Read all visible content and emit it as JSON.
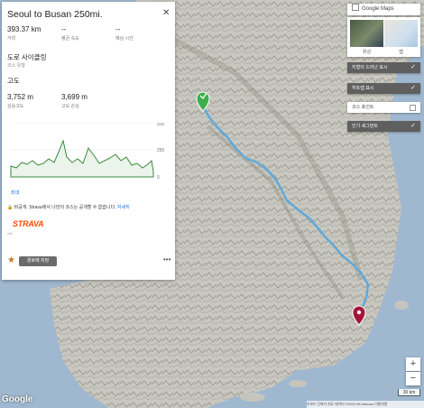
{
  "panel": {
    "title": "Seoul to Busan 250mi.",
    "stats": [
      {
        "value": "393.37 km",
        "label": "거리"
      },
      {
        "value": "--",
        "label": "평균 속도"
      },
      {
        "value": "--",
        "label": "예상 시간"
      }
    ],
    "activity_type": "도로 사이클링",
    "activity_sub": "코스 유형",
    "elevation_heading": "고도",
    "elevation_stats": [
      {
        "value": "3,752 m",
        "label": "상승고도"
      },
      {
        "value": "3,699 m",
        "label": "고도 손실"
      }
    ],
    "elevation_axis": [
      "500",
      "250",
      "0"
    ],
    "elevation_link": "최대",
    "privacy_text": "비공개. Strava에서 나만의 코스는 공개할 수 없습니다.",
    "privacy_link": "자세히",
    "brand": "STRAVA",
    "dots": "^^",
    "save_label": "경로에 저장",
    "more_icon": "•••",
    "star_icon": "star-icon",
    "accent_color": "#fc4c02"
  },
  "map_controls": {
    "google_maps_label": "Google Maps",
    "thumbnails": [
      {
        "label": "위성"
      },
      {
        "label": "맵"
      }
    ],
    "layers": [
      {
        "label": "지형이 드러난 표시",
        "checked": true
      },
      {
        "label": "히트맵 표시",
        "checked": true
      },
      {
        "label": "코스 포인트",
        "checked": false
      },
      {
        "label": "인기 세그먼트",
        "checked": true
      }
    ],
    "zoom_in": "+",
    "zoom_out": "−"
  },
  "footer": {
    "google": "Google",
    "attribution": "키보드 단축키  지도 데이터 ©2023 SK telecom  이용약관",
    "scale": "30 km"
  },
  "route_color": "#5fa9d9",
  "start_color": "#3dae49",
  "end_color": "#a3163a"
}
